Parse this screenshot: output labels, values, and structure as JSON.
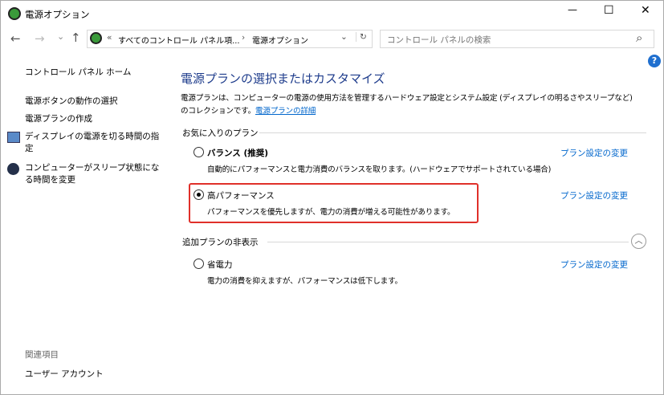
{
  "window": {
    "title": "電源オプション",
    "minimize": "—",
    "maximize": "☐",
    "close": "✕"
  },
  "nav": {
    "back": "←",
    "forward": "→",
    "recent": "⌄",
    "up": "↑",
    "breadcrumb_prefix": "«",
    "crumb1": "すべてのコントロール パネル項...",
    "sep": "›",
    "crumb2": "電源オプション",
    "dropdown": "⌄",
    "refresh": "↻",
    "search_placeholder": "コントロール パネルの検索",
    "search_icon": "⌕"
  },
  "help": "?",
  "sidebar": {
    "home": "コントロール パネル ホーム",
    "items": [
      "電源ボタンの動作の選択",
      "電源プランの作成",
      "ディスプレイの電源を切る時間の指定",
      "コンピューターがスリープ状態になる時間を変更"
    ],
    "related_title": "関連項目",
    "related": [
      "ユーザー アカウント"
    ]
  },
  "main": {
    "heading": "電源プランの選択またはカスタマイズ",
    "desc_line1": "電源プランは、コンピューターの電源の使用方法を管理するハードウェア設定とシステム設定 (ディスプレイの明るさやスリープなど)",
    "desc_line2": "のコレクションです。",
    "desc_link": "電源プランの詳細",
    "favorites_label": "お気に入りのプラン",
    "hidden_label": "追加プランの非表示",
    "change_link": "プラン設定の変更",
    "plans": [
      {
        "name": "バランス (推奨)",
        "desc": "自動的にパフォーマンスと電力消費のバランスを取ります。(ハードウェアでサポートされている場合)",
        "selected": false
      },
      {
        "name": "高パフォーマンス",
        "desc": "パフォーマンスを優先しますが、電力の消費が増える可能性があります。",
        "selected": true
      },
      {
        "name": "省電力",
        "desc": "電力の消費を抑えますが、パフォーマンスは低下します。",
        "selected": false
      }
    ]
  },
  "colors": {
    "heading": "#1e3c8c",
    "link": "#0066cc",
    "highlight": "#e0302a"
  }
}
